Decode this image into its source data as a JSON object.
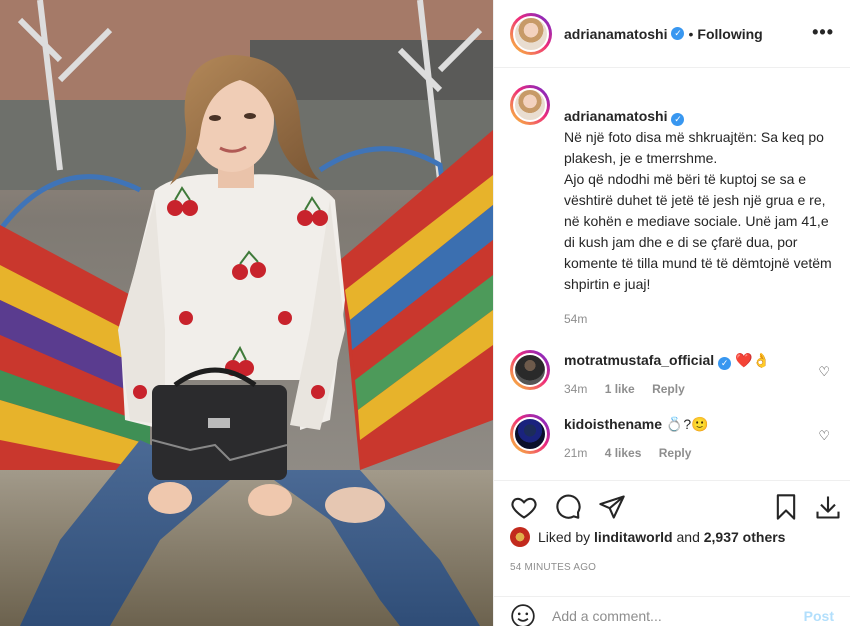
{
  "post": {
    "username": "adrianamatoshi",
    "follow_status": "Following",
    "caption": "Në një foto disa më shkruajtën: Sa keq po plakesh, je e tmerrshme.\nAjo që ndodhi më bëri të kuptoj se sa e vështirë duhet të jetë të jesh një grua e re, në kohën e mediave sociale. Unë jam 41,e di kush jam dhe e di se çfarë dua, por komente të tilla mund të të dëmtojnë vetëm shpirtin e juaj!",
    "caption_time": "54m",
    "timestamp": "54 MINUTES AGO",
    "liked_by_prefix": "Liked by",
    "liked_by_user": "linditaworld",
    "liked_and": "and",
    "likes_count": "2,937 others",
    "comment_placeholder": "Add a comment...",
    "post_label": "Post"
  },
  "comments": [
    {
      "username": "motratmustafa_official",
      "text": "❤️👌",
      "time": "34m",
      "likes": "1 like",
      "reply": "Reply"
    },
    {
      "username": "kidoisthename",
      "text": "💍?🙂",
      "time": "21m",
      "likes": "4 likes",
      "reply": "Reply"
    }
  ],
  "icons": {
    "more": "more-options-icon",
    "verified": "verified-badge-icon",
    "like": "heart-icon",
    "comment": "comment-icon",
    "share": "share-icon",
    "save": "bookmark-icon",
    "download": "download-icon",
    "emoji": "emoji-icon"
  },
  "colors": {
    "verified": "#3897f0",
    "text": "#262626",
    "muted": "#8e8e8e",
    "post_disabled": "#b2dffc"
  }
}
